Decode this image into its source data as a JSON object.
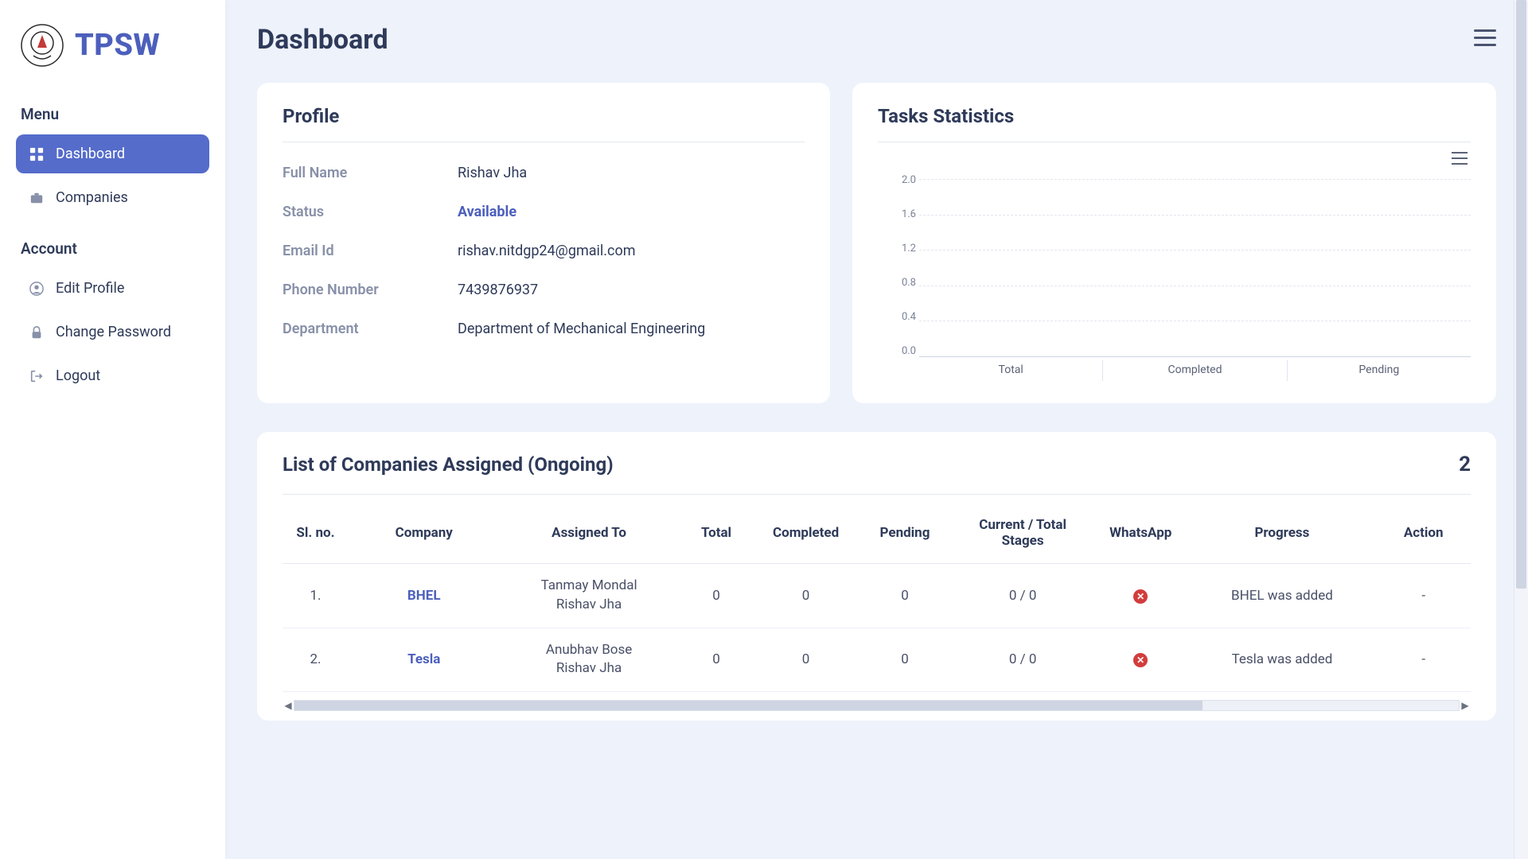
{
  "brand": {
    "name": "TPSW"
  },
  "sidebar": {
    "section_menu": "Menu",
    "section_account": "Account",
    "items_menu": [
      {
        "label": "Dashboard",
        "icon": "grid-icon",
        "active": true
      },
      {
        "label": "Companies",
        "icon": "briefcase-icon",
        "active": false
      }
    ],
    "items_account": [
      {
        "label": "Edit Profile",
        "icon": "user-circle-icon"
      },
      {
        "label": "Change Password",
        "icon": "lock-icon"
      },
      {
        "label": "Logout",
        "icon": "logout-icon"
      }
    ]
  },
  "page": {
    "title": "Dashboard"
  },
  "profile": {
    "title": "Profile",
    "rows": {
      "full_name_label": "Full Name",
      "full_name_value": "Rishav Jha",
      "status_label": "Status",
      "status_value": "Available",
      "email_label": "Email Id",
      "email_value": "rishav.nitdgp24@gmail.com",
      "phone_label": "Phone Number",
      "phone_value": "7439876937",
      "dept_label": "Department",
      "dept_value": "Department of Mechanical Engineering"
    }
  },
  "stats": {
    "title": "Tasks Statistics"
  },
  "chart_data": {
    "type": "bar",
    "categories": [
      "Total",
      "Completed",
      "Pending"
    ],
    "values": [
      0,
      0,
      0
    ],
    "title": "",
    "xlabel": "",
    "ylabel": "",
    "ylim": [
      0,
      2.0
    ],
    "y_ticks": [
      "2.0",
      "1.6",
      "1.2",
      "0.8",
      "0.4",
      "0.0"
    ]
  },
  "companies": {
    "title": "List of Companies Assigned (Ongoing)",
    "count": "2",
    "columns": {
      "sl": "Sl. no.",
      "company": "Company",
      "assigned": "Assigned To",
      "total": "Total",
      "completed": "Completed",
      "pending": "Pending",
      "stages": "Current / Total Stages",
      "whatsapp": "WhatsApp",
      "progress": "Progress",
      "action": "Action"
    },
    "rows": [
      {
        "sl": "1.",
        "company": "BHEL",
        "assigned": [
          "Tanmay Mondal",
          "Rishav Jha"
        ],
        "total": "0",
        "completed": "0",
        "pending": "0",
        "stages": "0 / 0",
        "whatsapp": "no",
        "progress": "BHEL was added",
        "action": "-"
      },
      {
        "sl": "2.",
        "company": "Tesla",
        "assigned": [
          "Anubhav Bose",
          "Rishav Jha"
        ],
        "total": "0",
        "completed": "0",
        "pending": "0",
        "stages": "0 / 0",
        "whatsapp": "no",
        "progress": "Tesla was added",
        "action": "-"
      }
    ]
  }
}
